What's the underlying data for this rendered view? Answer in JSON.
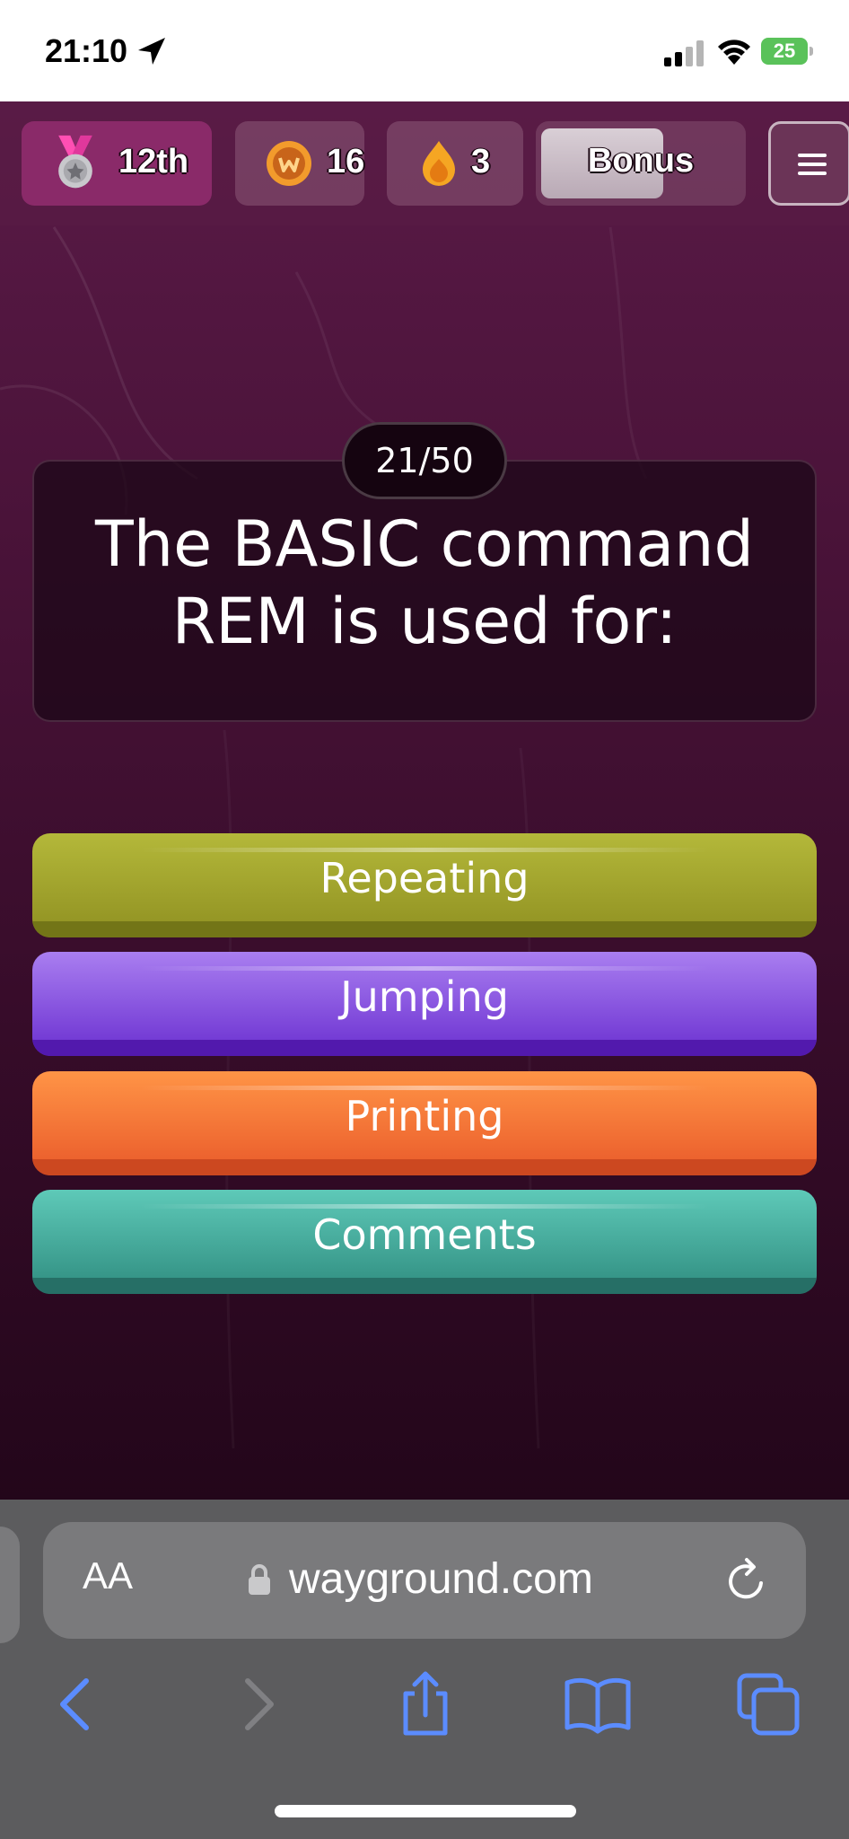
{
  "status_bar": {
    "time": "21:10",
    "battery": "25"
  },
  "topbar": {
    "rank": "12th",
    "coins": "16",
    "streak": "3",
    "bonus_label": "Bonus"
  },
  "question": {
    "counter": "21/50",
    "text": "The BASIC command REM is used for:"
  },
  "answers": [
    {
      "label": "Repeating",
      "color": "#a3a62c"
    },
    {
      "label": "Jumping",
      "color": "#8a55e3"
    },
    {
      "label": "Printing",
      "color": "#f37538"
    },
    {
      "label": "Comments",
      "color": "#46a99b"
    }
  ],
  "browser": {
    "aa_label": "AA",
    "url": "wayground.com"
  },
  "colors": {
    "accent_blue": "#5b8cff",
    "rank_pill": "#8a2a69"
  }
}
